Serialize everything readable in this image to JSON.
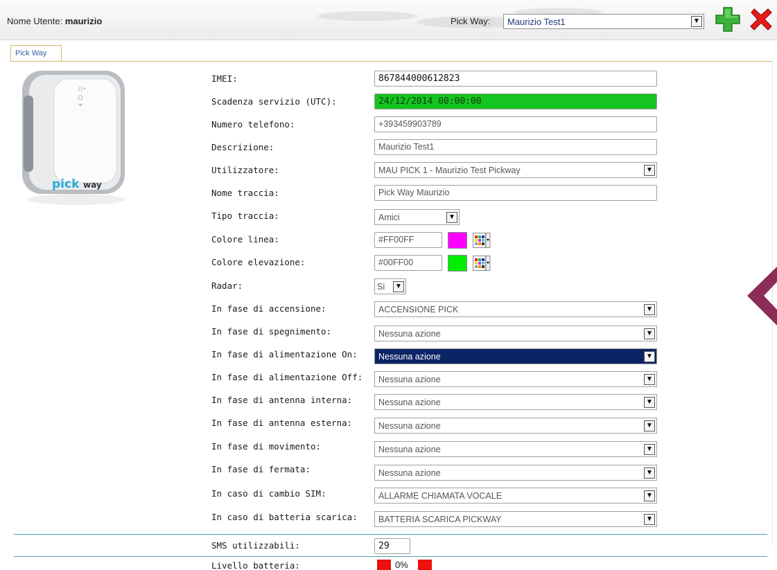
{
  "header": {
    "user_label": "Nome Utente: ",
    "user_name": "maurizio",
    "pick_label": "Pick Way:",
    "pick_selected": "Maurizio Test1"
  },
  "tab": {
    "label": "Pick Way"
  },
  "fields": {
    "imei": {
      "label": "IMEI:",
      "value": "867844000612823"
    },
    "scadenza": {
      "label": "Scadenza servizio (UTC):",
      "value": "24/12/2014 00:00:00"
    },
    "telefono": {
      "label": "Numero telefono:",
      "value": "+393459903789"
    },
    "descrizione": {
      "label": "Descrizione:",
      "value": "Maurizio Test1"
    },
    "utilizzatore": {
      "label": "Utilizzatore:",
      "value": "MAU PICK 1 - Maurizio Test Pickway"
    },
    "nome_traccia": {
      "label": "Nome traccia:",
      "value": "Pick Way Maurizio"
    },
    "tipo_traccia": {
      "label": "Tipo traccia:",
      "value": "Amici"
    },
    "colore_linea": {
      "label": "Colore linea:",
      "value": "#FF00FF",
      "swatch": "#ff00ff"
    },
    "colore_elevazione": {
      "label": "Colore elevazione:",
      "value": "#00FF00",
      "swatch": "#00ee00"
    },
    "radar": {
      "label": "Radar:",
      "value": "Si"
    },
    "accensione": {
      "label": "In fase di accensione:",
      "value": "ACCENSIONE PICK"
    },
    "spegnimento": {
      "label": "In fase di spegnimento:",
      "value": "Nessuna azione"
    },
    "alim_on": {
      "label": "In fase di alimentazione On:",
      "value": "Nessuna azione"
    },
    "alim_off": {
      "label": "In fase di alimentazione Off:",
      "value": "Nessuna azione"
    },
    "ant_int": {
      "label": "In fase di antenna interna:",
      "value": "Nessuna azione"
    },
    "ant_est": {
      "label": "In fase di antenna esterna:",
      "value": "Nessuna azione"
    },
    "movimento": {
      "label": "In fase di movimento:",
      "value": "Nessuna azione"
    },
    "fermata": {
      "label": "In fase di fermata:",
      "value": "Nessuna azione"
    },
    "cambio_sim": {
      "label": "In caso di cambio SIM:",
      "value": "ALLARME CHIAMATA VOCALE"
    },
    "batt_scarica": {
      "label": "In caso di batteria scarica:",
      "value": "BATTERIA SCARICA PICKWAY"
    },
    "sms": {
      "label": "SMS utilizzabili:",
      "value": "29"
    },
    "batteria": {
      "label": "Livello batteria:",
      "value": "0%",
      "percent": 0
    }
  },
  "device_logo": "pickway",
  "colors": {
    "accent_line": "#4aa0a8",
    "highlight_select": "#0b2466",
    "expiry_ok": "#16c41f",
    "battery": "#ee0f0f"
  },
  "icons": [
    "add-icon",
    "delete-icon",
    "chevron-down-icon",
    "color-palette-icon",
    "chevron-left-icon"
  ]
}
